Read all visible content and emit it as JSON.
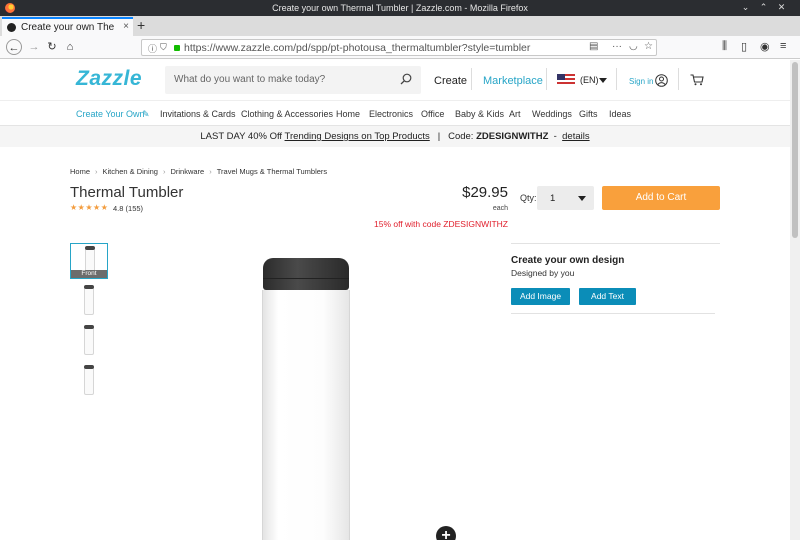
{
  "window": {
    "title": "Create your own Thermal Tumbler | Zazzle.com - Mozilla Firefox"
  },
  "tab": {
    "label": "Create your own The",
    "close": "×",
    "new_tab": "+"
  },
  "navbar": {
    "url_host": "https://www.zazzle.com",
    "url_path": "/pd/spp/pt-photousa_thermaltumbler?style=tumbler"
  },
  "header": {
    "logo": "Zazzle",
    "search_placeholder": "What do you want to make today?",
    "create_label": "Create",
    "marketplace_label": "Marketplace",
    "locale_label": "(EN)",
    "signin_label": "Sign in"
  },
  "categories": [
    "Create Your Own",
    "Invitations & Cards",
    "Clothing & Accessories",
    "Home",
    "Electronics",
    "Office",
    "Baby & Kids",
    "Art",
    "Weddings",
    "Gifts",
    "Ideas"
  ],
  "promo": {
    "lead": "LAST DAY  40% Off",
    "link": "Trending Designs on Top Products",
    "code_label": "Code:",
    "code": "ZDESIGNWITHZ",
    "details": "details"
  },
  "breadcrumbs": [
    "Home",
    "Kitchen & Dining",
    "Drinkware",
    "Travel Mugs & Thermal Tumblers"
  ],
  "product": {
    "title": "Thermal Tumbler",
    "stars": "★★★★★",
    "rating": "4.8",
    "review_count": "(155)",
    "price": "$29.95",
    "price_unit": "each",
    "discount": "15% off with code ZDESIGNWITHZ",
    "qty_label": "Qty:",
    "qty_value": "1",
    "add_to_cart": "Add to Cart",
    "thumb_label": "Front"
  },
  "design": {
    "heading": "Create your own design",
    "designed_by": "Designed by you",
    "add_image": "Add Image",
    "add_text": "Add Text"
  },
  "colors": {
    "brand": "#36b6d6",
    "cta": "#f9a03c",
    "accent_button": "#0b8db8",
    "discount": "#e0202d",
    "stars": "#f39c3d"
  },
  "icons": [
    "back-icon",
    "forward-icon",
    "reload-icon",
    "home-icon",
    "lock-icon",
    "search-icon",
    "flag-icon",
    "user-icon",
    "cart-icon",
    "zoom-icon",
    "menu-icon",
    "library-icon"
  ]
}
